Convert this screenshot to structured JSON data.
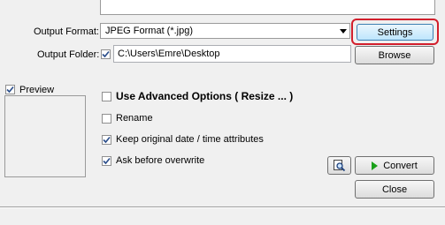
{
  "output_format": {
    "label": "Output Format:",
    "selected": "JPEG Format (*.jpg)",
    "settings_button": "Settings"
  },
  "output_folder": {
    "label": "Output Folder:",
    "checked": true,
    "value": "C:\\Users\\Emre\\Desktop",
    "browse_button": "Browse"
  },
  "preview": {
    "label": "Preview",
    "checked": true
  },
  "options": [
    {
      "label": "Use Advanced Options ( Resize ... )",
      "checked": false,
      "bold": true
    },
    {
      "label": "Rename",
      "checked": false,
      "bold": false
    },
    {
      "label": "Keep original date / time attributes",
      "checked": true,
      "bold": false
    },
    {
      "label": "Ask before overwrite",
      "checked": true,
      "bold": false
    }
  ],
  "actions": {
    "search_icon": "magnifier-document-icon",
    "convert_button": "Convert",
    "close_button": "Close"
  },
  "colors": {
    "highlight": "#d21f2c",
    "convert_icon": "#1aa01a"
  }
}
